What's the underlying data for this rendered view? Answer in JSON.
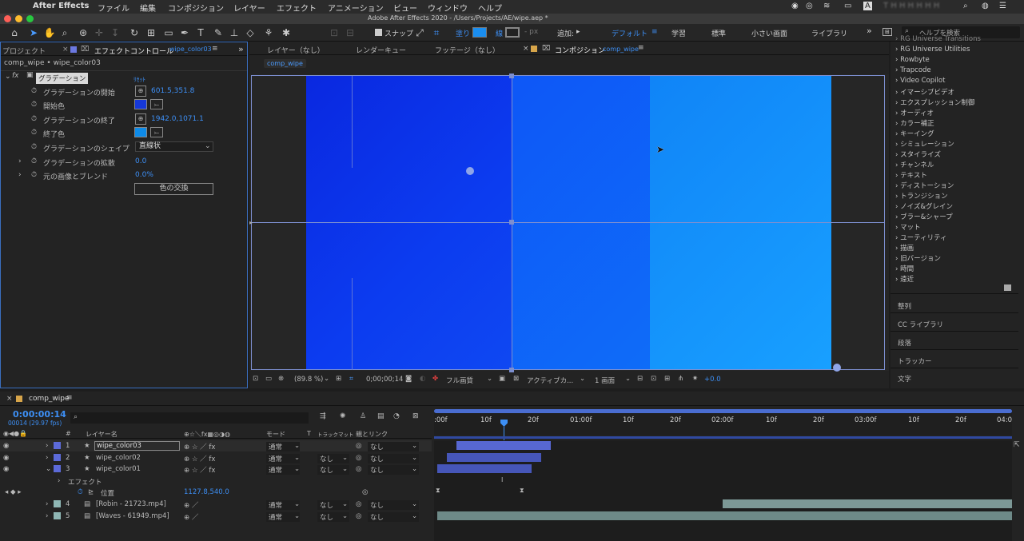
{
  "menubar": {
    "app": "After Effects",
    "items": [
      "ファイル",
      "編集",
      "コンポジション",
      "レイヤー",
      "エフェクト",
      "アニメーション",
      "ビュー",
      "ウィンドウ",
      "ヘルプ"
    ],
    "time": "T H H H  H H H"
  },
  "titlebar": {
    "title": "Adobe After Effects 2020 - /Users/Projects/AE/wipe.aep *"
  },
  "toolbar": {
    "snap": "スナップ",
    "fill": "塗り",
    "stroke": "線",
    "px": "- px",
    "add": "追加:",
    "workspaces": [
      "デフォルト",
      "学習",
      "標準",
      "小さい画面",
      "ライブラリ"
    ],
    "search_placeholder": "ヘルプを検索",
    "more": "»"
  },
  "left_panel": {
    "tab_project": "プロジェクト",
    "tab_effects": "エフェクトコントロール",
    "tab_layer": "wipe_color03",
    "breadcrumb": "comp_wipe • wipe_color03",
    "effect_name": "グラデーション",
    "reset": "ﾘｾｯﾄ",
    "tooltip": "グラデーション",
    "props": [
      {
        "label": "グラデーションの開始",
        "value": "601.5,351.8"
      },
      {
        "label": "開始色",
        "value": ""
      },
      {
        "label": "グラデーションの終了",
        "value": "1942.0,1071.1"
      },
      {
        "label": "終了色",
        "value": ""
      },
      {
        "label": "グラデーションのシェイプ",
        "value": "直線状"
      },
      {
        "label": "グラデーションの拡散",
        "value": "0.0"
      },
      {
        "label": "元の画像とブレンド",
        "value": "0.0%"
      }
    ],
    "swap_button": "色の交換",
    "start_color": "#1638d8",
    "end_color": "#0e8be8"
  },
  "viewer": {
    "tabs": [
      "レイヤー（なし）",
      "レンダーキュー",
      "フッテージ（なし）",
      "コンポジション"
    ],
    "comp_tab_name": "comp_wipe",
    "sub_tab": "comp_wipe",
    "zoom": "(89.8 %)",
    "timecode": "0;00;00;14",
    "quality": "フル画質",
    "camera": "アクティブカ...",
    "views": "1 画面",
    "exposure": "+0.0"
  },
  "effects_list": {
    "items": [
      "RG Universe Transitions",
      "RG Universe Utilities",
      "Rowbyte",
      "Trapcode",
      "Video Copilot",
      "イマーシブビデオ",
      "エクスプレッション制御",
      "オーディオ",
      "カラー補正",
      "キーイング",
      "シミュレーション",
      "スタイライズ",
      "チャンネル",
      "テキスト",
      "ディストーション",
      "トランジション",
      "ノイズ&グレイン",
      "ブラー&シャープ",
      "マット",
      "ユーティリティ",
      "描画",
      "旧バージョン",
      "時間",
      "遠近"
    ],
    "panels": [
      "整列",
      "CC ライブラリ",
      "段落",
      "トラッカー",
      "文字"
    ]
  },
  "timeline": {
    "tab": "comp_wipe",
    "timecode": "0:00:00:14",
    "fps": "00014 (29.97 fps)",
    "col_name": "レイヤー名",
    "col_mode": "モード",
    "col_t": "T",
    "col_trkmat": "トラックマット",
    "col_parent": "親とリンク",
    "ruler": [
      ":00f",
      "10f",
      "20f",
      "01:00f",
      "10f",
      "20f",
      "02:00f",
      "10f",
      "20f",
      "03:00f",
      "10f",
      "20f",
      "04:0"
    ],
    "layers": [
      {
        "num": "1",
        "name": "wipe_color03",
        "mode": "通常",
        "trk": "",
        "parent": "なし",
        "color": "#5c6ad8"
      },
      {
        "num": "2",
        "name": "wipe_color02",
        "mode": "通常",
        "trk": "なし",
        "parent": "なし",
        "color": "#5c6ad8"
      },
      {
        "num": "3",
        "name": "wipe_color01",
        "mode": "通常",
        "trk": "なし",
        "parent": "なし",
        "color": "#5c6ad8"
      },
      {
        "num": "4",
        "name": "[Robin - 21723.mp4]",
        "mode": "通常",
        "trk": "なし",
        "parent": "なし",
        "color": "#8fb7b5"
      },
      {
        "num": "5",
        "name": "[Waves - 61949.mp4]",
        "mode": "通常",
        "trk": "なし",
        "parent": "なし",
        "color": "#8fb7b5"
      }
    ],
    "effect_group": "エフェクト",
    "position_label": "位置",
    "position_value": "1127.8,540.0"
  }
}
